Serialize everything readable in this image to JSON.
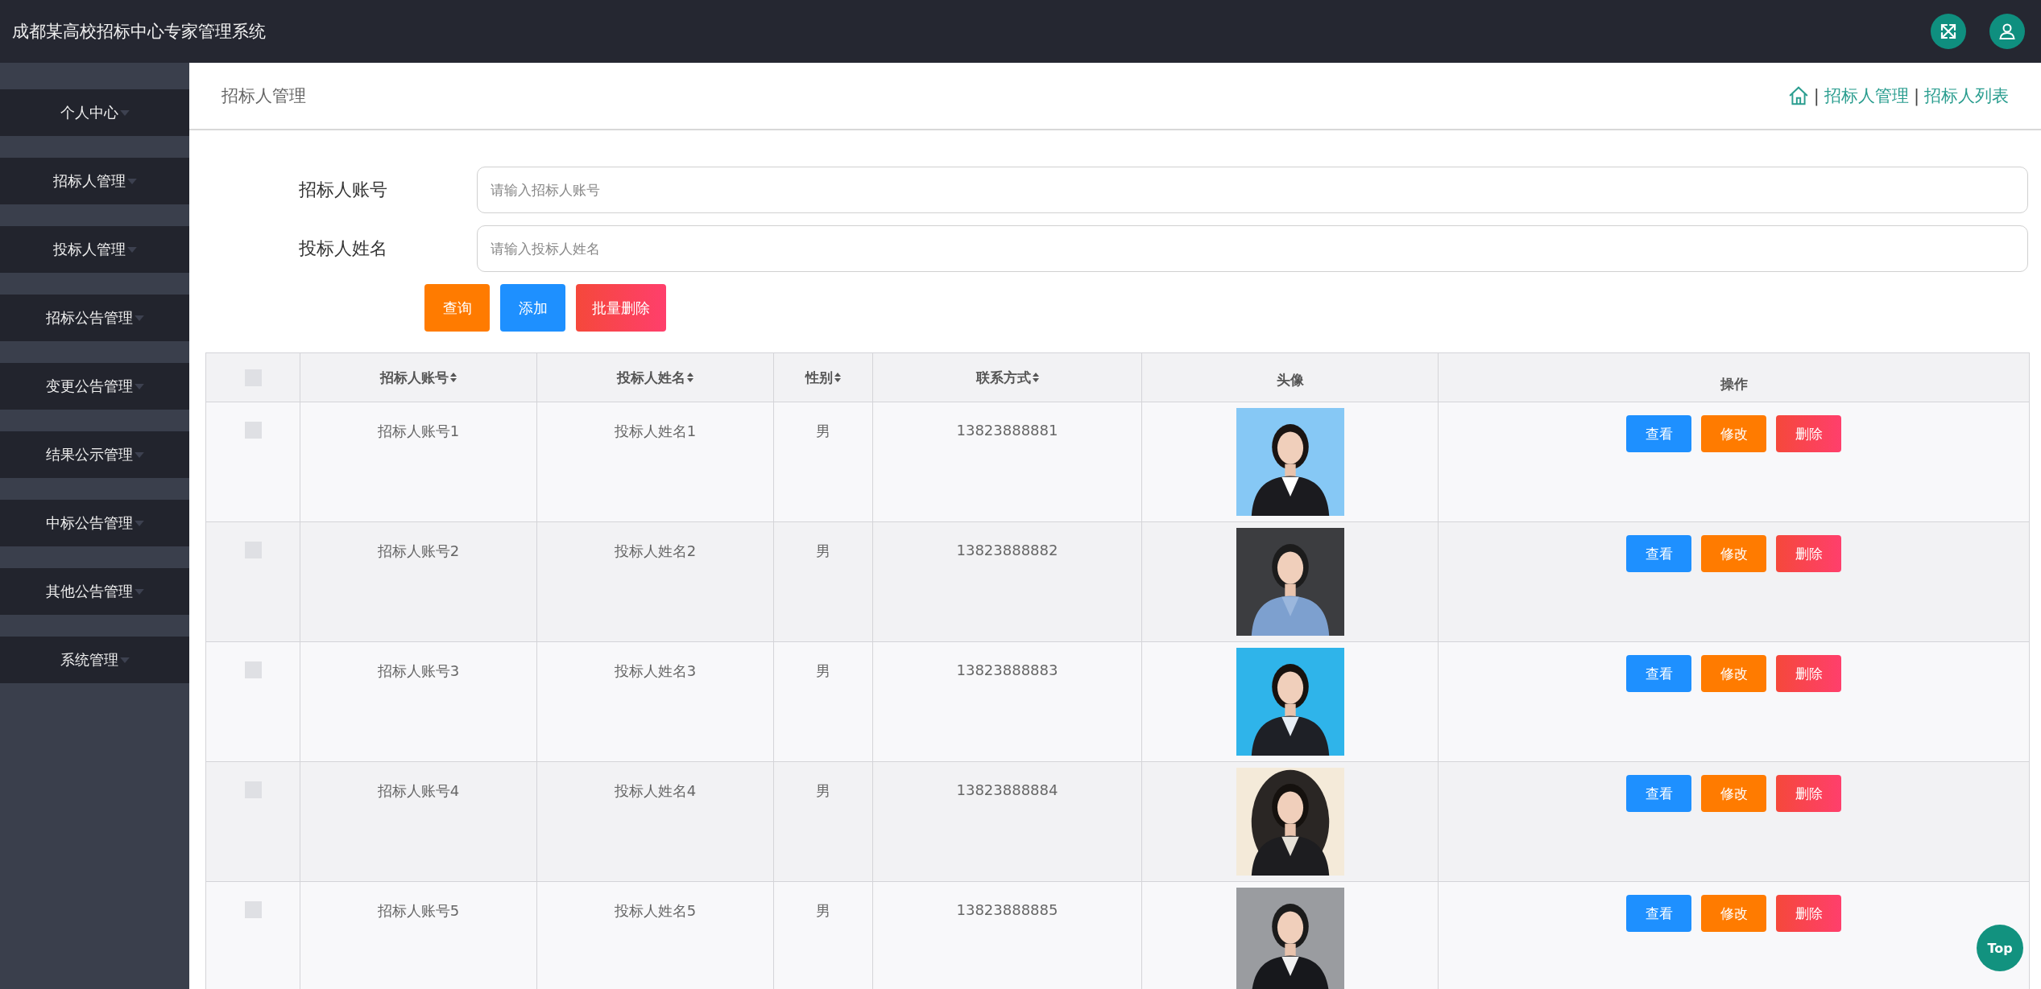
{
  "app_title": "成都某高校招标中心专家管理系统",
  "sidebar": {
    "items": [
      {
        "label": "个人中心"
      },
      {
        "label": "招标人管理"
      },
      {
        "label": "投标人管理"
      },
      {
        "label": "招标公告管理"
      },
      {
        "label": "变更公告管理"
      },
      {
        "label": "结果公示管理"
      },
      {
        "label": "中标公告管理"
      },
      {
        "label": "其他公告管理"
      },
      {
        "label": "系统管理"
      }
    ]
  },
  "page_title": "招标人管理",
  "breadcrumb": [
    {
      "kind": "home"
    },
    {
      "kind": "separator",
      "text": "|"
    },
    {
      "kind": "link",
      "text": "招标人管理"
    },
    {
      "kind": "separator",
      "text": "|"
    },
    {
      "kind": "link",
      "text": "招标人列表"
    }
  ],
  "search_form": {
    "fields": [
      {
        "label": "招标人账号",
        "placeholder": "请输入招标人账号"
      },
      {
        "label": "投标人姓名",
        "placeholder": "请输入投标人姓名"
      }
    ],
    "buttons": [
      {
        "label": "查询",
        "kind": "search"
      },
      {
        "label": "添加",
        "kind": "add"
      },
      {
        "label": "批量删除",
        "kind": "delete"
      }
    ]
  },
  "table": {
    "select_all": {
      "checked": false
    },
    "columns": [
      {
        "label": "招标人账号",
        "sortable": true
      },
      {
        "label": "投标人姓名",
        "sortable": true
      },
      {
        "label": "性别",
        "sortable": true
      },
      {
        "label": "联系方式",
        "sortable": true
      },
      {
        "label": "头像",
        "sortable": false
      },
      {
        "label": "操作",
        "sortable": false
      }
    ],
    "rows": [
      {
        "checked": false,
        "account": "招标人账号1",
        "name": "投标人姓名1",
        "gender": "男",
        "phone": "13823888881",
        "actions": [
          {
            "label": "查看",
            "kind": "view"
          },
          {
            "label": "修改",
            "kind": "edit"
          },
          {
            "label": "删除",
            "kind": "delete"
          }
        ]
      },
      {
        "checked": false,
        "account": "招标人账号2",
        "name": "投标人姓名2",
        "gender": "男",
        "phone": "13823888882",
        "actions": [
          {
            "label": "查看",
            "kind": "view"
          },
          {
            "label": "修改",
            "kind": "edit"
          },
          {
            "label": "删除",
            "kind": "delete"
          }
        ]
      },
      {
        "checked": false,
        "account": "招标人账号3",
        "name": "投标人姓名3",
        "gender": "男",
        "phone": "13823888883",
        "actions": [
          {
            "label": "查看",
            "kind": "view"
          },
          {
            "label": "修改",
            "kind": "edit"
          },
          {
            "label": "删除",
            "kind": "delete"
          }
        ]
      },
      {
        "checked": false,
        "account": "招标人账号4",
        "name": "投标人姓名4",
        "gender": "男",
        "phone": "13823888884",
        "actions": [
          {
            "label": "查看",
            "kind": "view"
          },
          {
            "label": "修改",
            "kind": "edit"
          },
          {
            "label": "删除",
            "kind": "delete"
          }
        ]
      },
      {
        "checked": false,
        "account": "招标人账号5",
        "name": "投标人姓名5",
        "gender": "男",
        "phone": "13823888885",
        "actions": [
          {
            "label": "查看",
            "kind": "view"
          },
          {
            "label": "修改",
            "kind": "edit"
          },
          {
            "label": "删除",
            "kind": "delete"
          }
        ]
      }
    ]
  },
  "back_to_top": "Top"
}
